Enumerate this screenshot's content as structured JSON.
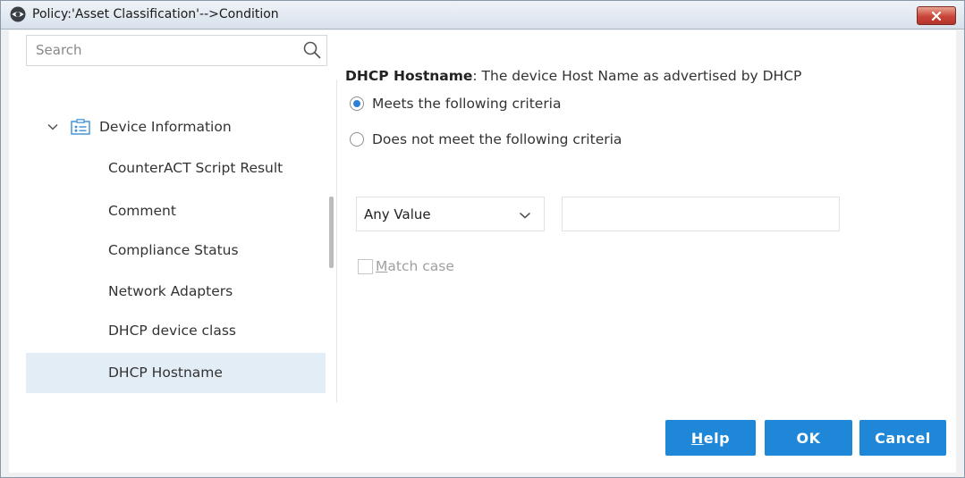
{
  "window": {
    "title": "Policy:'Asset Classification'-->Condition"
  },
  "search": {
    "placeholder": "Search"
  },
  "tree": {
    "group_label": "Device Information",
    "items": [
      {
        "label": "CounterACT Script Result"
      },
      {
        "label": "Comment"
      },
      {
        "label": "Compliance Status"
      },
      {
        "label": "Network Adapters"
      },
      {
        "label": "DHCP device class"
      },
      {
        "label": "DHCP Hostname",
        "selected": true
      }
    ]
  },
  "property": {
    "name": "DHCP Hostname",
    "description": ": The device Host Name as advertised by DHCP"
  },
  "criteria": {
    "option_meets": "Meets the following criteria",
    "option_not_meets": "Does not meet the following criteria",
    "selected": "meets"
  },
  "operator": {
    "value": "Any Value"
  },
  "match_case": {
    "label_first": "M",
    "label_rest": "atch case",
    "checked": false,
    "enabled": false
  },
  "buttons": {
    "help_first": "H",
    "help_rest": "elp",
    "ok": "OK",
    "cancel": "Cancel"
  },
  "colors": {
    "accent": "#1e87d8",
    "selected_row": "#e3edf6",
    "close_button": "#c9453a"
  }
}
